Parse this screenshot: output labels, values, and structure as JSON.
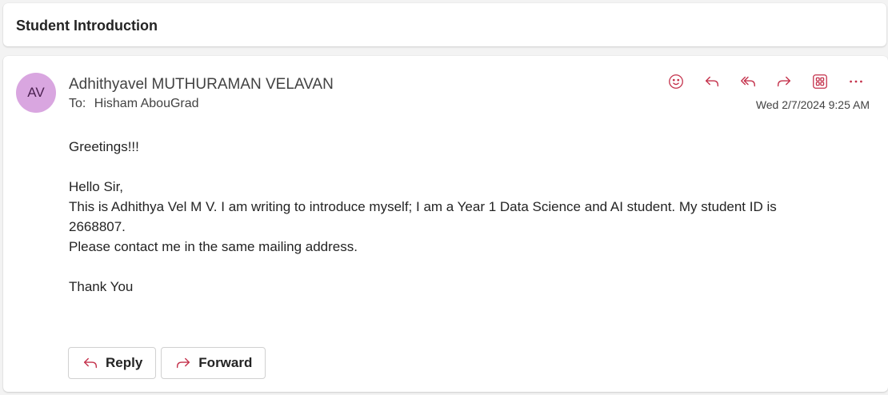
{
  "subject": "Student Introduction",
  "message": {
    "avatar_initials": "AV",
    "sender_name": "Adhithyavel MUTHURAMAN VELAVAN",
    "to_label": "To:",
    "recipient": "Hisham AbouGrad",
    "date": "Wed 2/7/2024 9:25 AM",
    "body": {
      "greeting": "Greetings!!!",
      "salutation": "Hello Sir,",
      "line1": "This is Adhithya Vel M V. I am writing to introduce myself; I am a Year 1 Data Science and AI student. My student ID is",
      "line2": "2668807.",
      "line3": "Please contact me in the same mailing address.",
      "closing": "Thank You"
    }
  },
  "toolbar": {
    "icons": [
      "emoji-icon",
      "reply-icon",
      "reply-all-icon",
      "forward-icon",
      "apps-icon",
      "more-icon"
    ]
  },
  "actions": {
    "reply_label": "Reply",
    "forward_label": "Forward"
  },
  "colors": {
    "accent_icon": "#c4314b",
    "avatar_bg": "#d9a6e0",
    "avatar_text": "#4a1f4f"
  }
}
